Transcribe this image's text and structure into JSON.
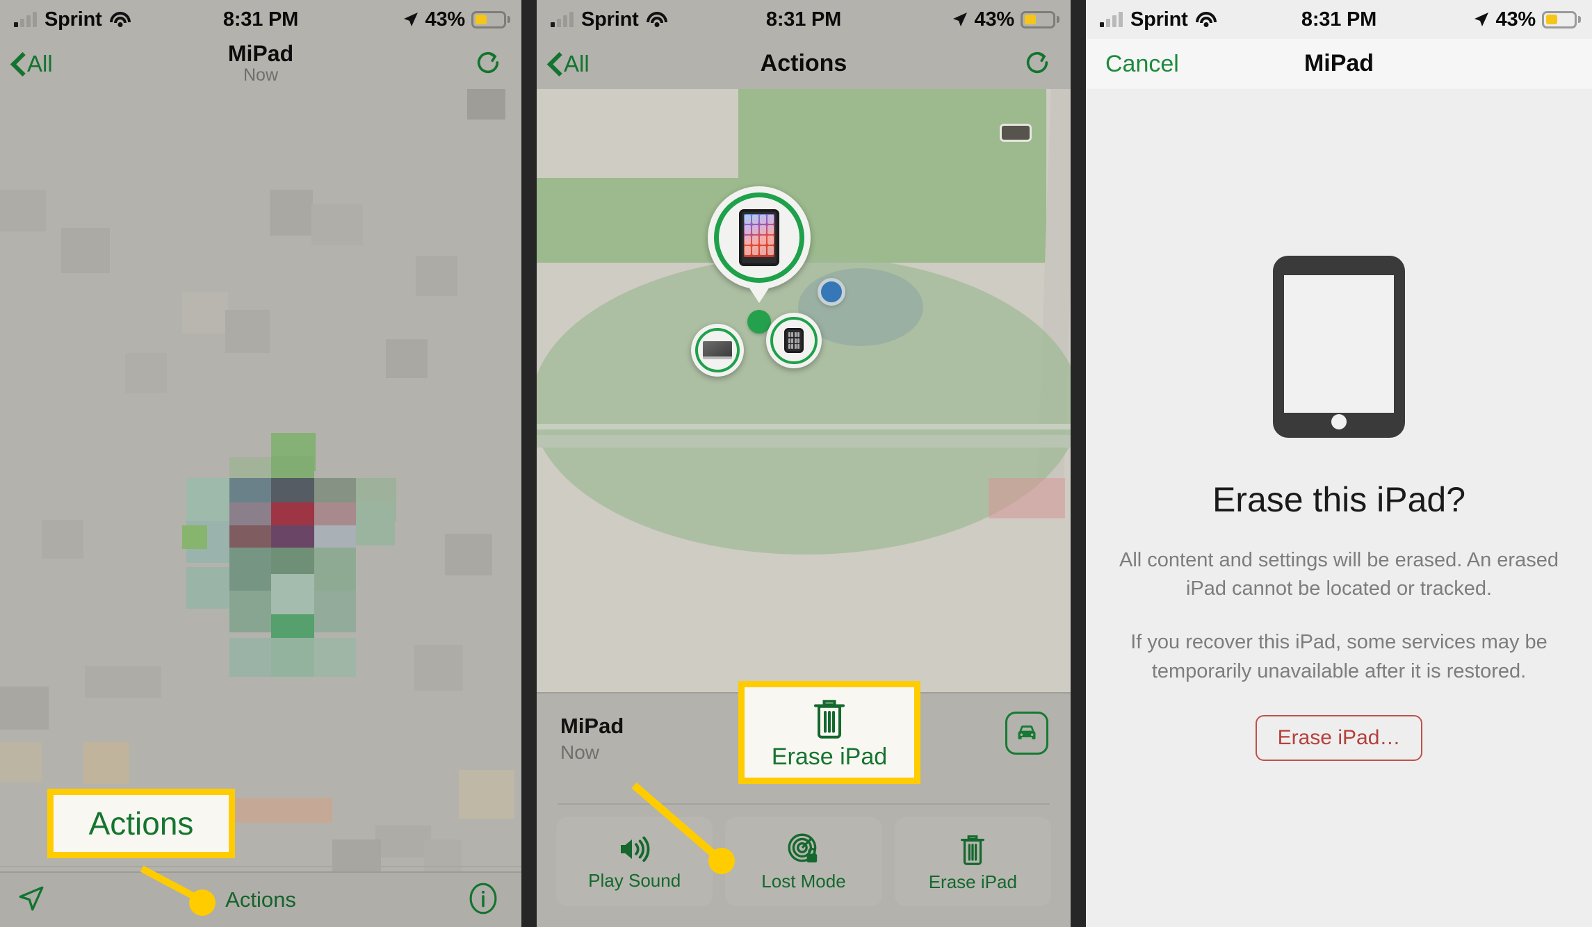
{
  "status_bar": {
    "carrier": "Sprint",
    "time": "8:31 PM",
    "battery_percent": "43%",
    "signal_icon": "cellular-bars-icon",
    "wifi_icon": "wifi-icon",
    "location_icon": "location-arrow-icon",
    "battery_icon": "battery-low-power-icon"
  },
  "colors": {
    "accent_green": "#12742f",
    "callout_yellow": "#ffcc00",
    "destructive_red": "#b5403c",
    "battery_yellow": "#f5c518",
    "map_green": "#9cba8d",
    "map_land": "#cfccc4"
  },
  "panel1": {
    "nav": {
      "back_label": "All",
      "back_icon": "chevron-left-icon",
      "title": "MiPad",
      "subtitle": "Now",
      "refresh_icon": "refresh-icon"
    },
    "toolbar": {
      "locate_icon": "location-arrow-icon",
      "actions_label": "Actions",
      "info_icon": "info-circle-icon"
    },
    "callout": {
      "label": "Actions"
    }
  },
  "panel2": {
    "nav": {
      "back_label": "All",
      "back_icon": "chevron-left-icon",
      "title": "Actions",
      "refresh_icon": "refresh-icon"
    },
    "map": {
      "pins": [
        {
          "name": "ipad-pin",
          "device": "iPad"
        },
        {
          "name": "macbook-pin",
          "device": "MacBook"
        },
        {
          "name": "watch-pin",
          "device": "Apple Watch"
        },
        {
          "name": "green-dot-pin",
          "device": "Device"
        },
        {
          "name": "blue-dot-pin",
          "device": "Current Location"
        }
      ],
      "battery_badge_icon": "map-battery-icon"
    },
    "sheet": {
      "device_name": "MiPad",
      "last_seen": "Now",
      "directions_icon": "car-icon",
      "actions": [
        {
          "label": "Play Sound",
          "icon": "speaker-waves-icon"
        },
        {
          "label": "Lost Mode",
          "icon": "radar-lock-icon"
        },
        {
          "label": "Erase iPad",
          "icon": "trash-icon"
        }
      ]
    },
    "callout": {
      "label": "Erase iPad",
      "icon": "trash-icon"
    }
  },
  "panel3": {
    "nav": {
      "cancel_label": "Cancel",
      "title": "MiPad"
    },
    "content": {
      "device_icon": "ipad-illustration-icon",
      "heading": "Erase this iPad?",
      "paragraph1": "All content and settings will be erased. An erased iPad cannot be located or tracked.",
      "paragraph2": "If you recover this iPad, some services may be temporarily unavailable after it is restored.",
      "erase_button_label": "Erase iPad…"
    }
  }
}
